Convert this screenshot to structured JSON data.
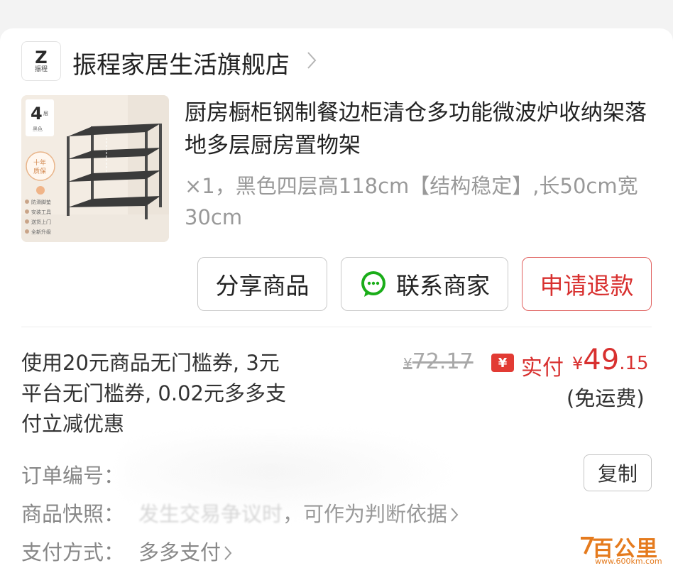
{
  "store": {
    "logo_letter": "Z",
    "logo_text": "振程",
    "name": "振程家居生活旗舰店",
    "chevron_icon": "chevron-right-icon"
  },
  "product": {
    "image_badge_number": "4",
    "image_badge_unit": "层",
    "image_badge_color": "黑色",
    "image_seal_line1": "十年",
    "image_seal_line2": "质保",
    "image_features": [
      "防滑脚垫",
      "安装工具",
      "送货上门",
      "全新升级"
    ],
    "title": "厨房橱柜钢制餐边柜清仓多功能微波炉收纳架落地多层厨房置物架",
    "spec": "×1，黑色四层高118cm【结构稳定】,长50cm宽30cm"
  },
  "actions": {
    "share_label": "分享商品",
    "contact_label": "联系商家",
    "refund_label": "申请退款",
    "contact_icon": "wechat-chat-icon"
  },
  "pricing": {
    "coupon_desc": "使用20元商品无门槛券, 3元平台无门槛券, 0.02元多多支付立减优惠",
    "currency_symbol": "¥",
    "original_price": "72.17",
    "paid_icon_symbol": "¥",
    "paid_label": "实付",
    "paid_price_int": "49",
    "paid_price_dec": ".15",
    "shipping_note": "(免运费)"
  },
  "order_info": {
    "order_number_label": "订单编号：",
    "copy_label": "复制",
    "snapshot_label": "商品快照：",
    "snapshot_value_blurred": "发生交易争议时",
    "snapshot_value": "，可作为判断依据",
    "payment_label": "支付方式：",
    "payment_value": "多多支付"
  },
  "watermark": {
    "text": "百公里",
    "url": "www.600km.com"
  },
  "colors": {
    "accent_red": "#d8302f",
    "watermark_orange": "#e57b1e",
    "wechat_green": "#1aad19"
  }
}
